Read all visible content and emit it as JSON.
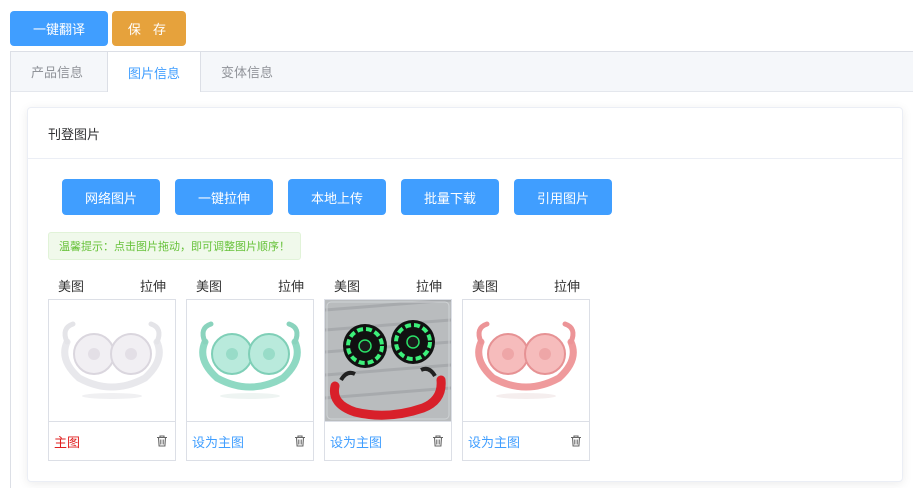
{
  "toolbar": {
    "translate_label": "一键翻译",
    "save_label": "保 存"
  },
  "tabs": [
    {
      "label": "产品信息",
      "active": false
    },
    {
      "label": "图片信息",
      "active": true
    },
    {
      "label": "变体信息",
      "active": false
    }
  ],
  "card": {
    "title": "刊登图片",
    "actions": [
      "网络图片",
      "一键拉伸",
      "本地上传",
      "批量下载",
      "引用图片"
    ],
    "tip": "温馨提示：点击图片拖动，即可调整图片顺序！"
  },
  "images": [
    {
      "beautify": "美图",
      "stretch": "拉伸",
      "footer": "主图",
      "is_main": true,
      "product_color": "white"
    },
    {
      "beautify": "美图",
      "stretch": "拉伸",
      "footer": "设为主图",
      "is_main": false,
      "product_color": "mint"
    },
    {
      "beautify": "美图",
      "stretch": "拉伸",
      "footer": "设为主图",
      "is_main": false,
      "product_color": "red-photo"
    },
    {
      "beautify": "美图",
      "stretch": "拉伸",
      "footer": "设为主图",
      "is_main": false,
      "product_color": "pink"
    }
  ],
  "colors": {
    "primary": "#409eff",
    "warning": "#e6a23c",
    "danger": "#e02020",
    "success": "#67c23a"
  },
  "icons": {
    "delete": "trash-icon"
  }
}
